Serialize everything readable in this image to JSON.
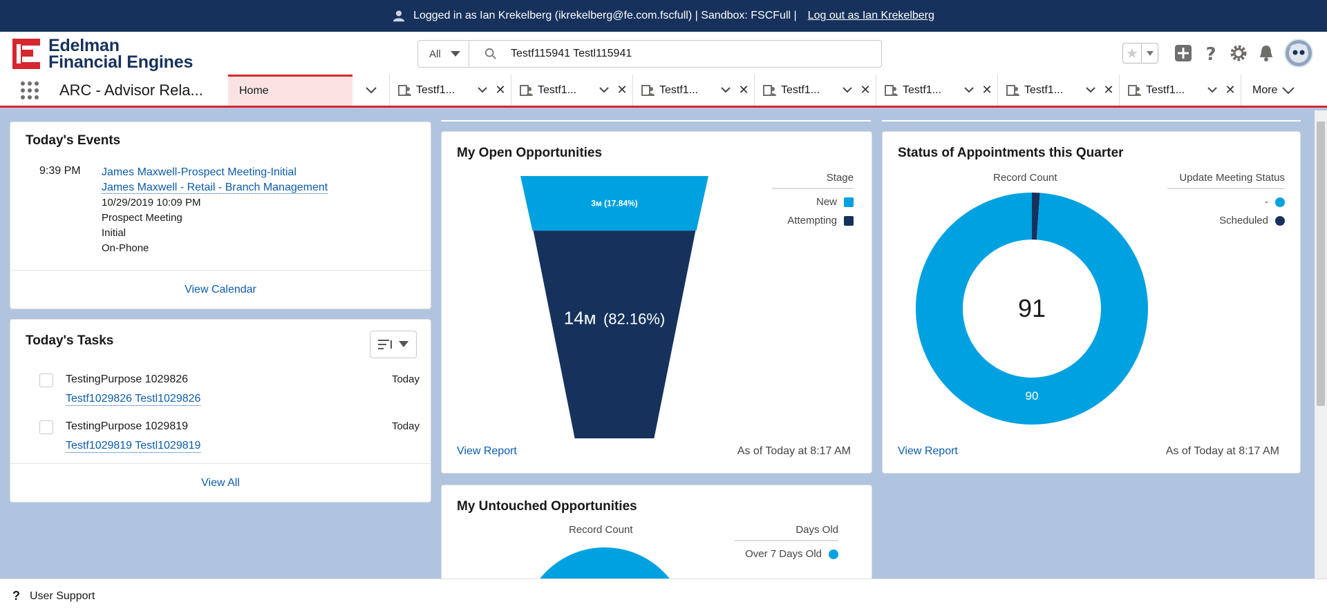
{
  "banner": {
    "text": "Logged in as Ian Krekelberg (ikrekelberg@fe.com.fscfull) | Sandbox: FSCFull |",
    "logout": "Log out as Ian Krekelberg"
  },
  "logo": {
    "line1": "Edelman",
    "line2": "Financial Engines"
  },
  "search": {
    "scope": "All",
    "value": "Testf115941 Testl115941"
  },
  "nav": {
    "app_name": "ARC - Advisor Rela...",
    "home_tab": "Home",
    "tabs": [
      "Testf1...",
      "Testf1...",
      "Testf1...",
      "Testf1...",
      "Testf1...",
      "Testf1...",
      "Testf1..."
    ],
    "more": "More"
  },
  "events": {
    "title": "Today's Events",
    "time": "9:39 PM",
    "subject": "James Maxwell-Prospect Meeting-Initial",
    "related": "James Maxwell - Retail - Branch Management",
    "datetime": "10/29/2019 10:09 PM",
    "type": "Prospect Meeting",
    "stage": "Initial",
    "mode": "On-Phone",
    "footer": "View Calendar"
  },
  "tasks": {
    "title": "Today's Tasks",
    "items": [
      {
        "name": "TestingPurpose 1029826",
        "date": "Today",
        "link": "Testf1029826 Testl1029826"
      },
      {
        "name": "TestingPurpose 1029819",
        "date": "Today",
        "link": "Testf1029819 Testl1029819"
      }
    ],
    "footer": "View All"
  },
  "opportunities": {
    "title": "My Open Opportunities",
    "legend_title": "Stage",
    "view_report": "View Report",
    "as_of": "As of Today at 8:17 AM"
  },
  "appointments": {
    "title": "Status of Appointments this Quarter",
    "axis_label": "Record Count",
    "legend_title": "Update Meeting Status",
    "view_report": "View Report",
    "as_of": "As of Today at 8:17 AM"
  },
  "untouched": {
    "title": "My Untouched Opportunities",
    "axis_label": "Record Count",
    "legend_title": "Days Old"
  },
  "footer": {
    "label": "User Support"
  },
  "colors": {
    "light_blue": "#00a1e0",
    "dark_navy": "#16325c",
    "banner": "#16325c",
    "accent_red": "#d7262e"
  },
  "chart_data": [
    {
      "type": "funnel",
      "title": "My Open Opportunities",
      "legend_title": "Stage",
      "categories": [
        "New",
        "Attempting"
      ],
      "values": [
        3000000,
        14000000
      ],
      "labels": [
        "3м (17.84%)",
        "14м (82.16%)"
      ],
      "label_main": "14м",
      "label_pct": "(82.16%)",
      "colors": [
        "#00a1e0",
        "#16325c"
      ]
    },
    {
      "type": "donut",
      "title": "Status of Appointments this Quarter",
      "legend_title": "Update Meeting Status",
      "categories": [
        "-",
        "Scheduled"
      ],
      "values": [
        90,
        1
      ],
      "total": "91",
      "slice_label": "90",
      "colors": [
        "#00a1e0",
        "#16325c"
      ]
    },
    {
      "type": "donut",
      "title": "My Untouched Opportunities",
      "legend_title": "Days Old",
      "categories": [
        "Over 7 Days Old"
      ],
      "colors": [
        "#00a1e0"
      ]
    }
  ]
}
